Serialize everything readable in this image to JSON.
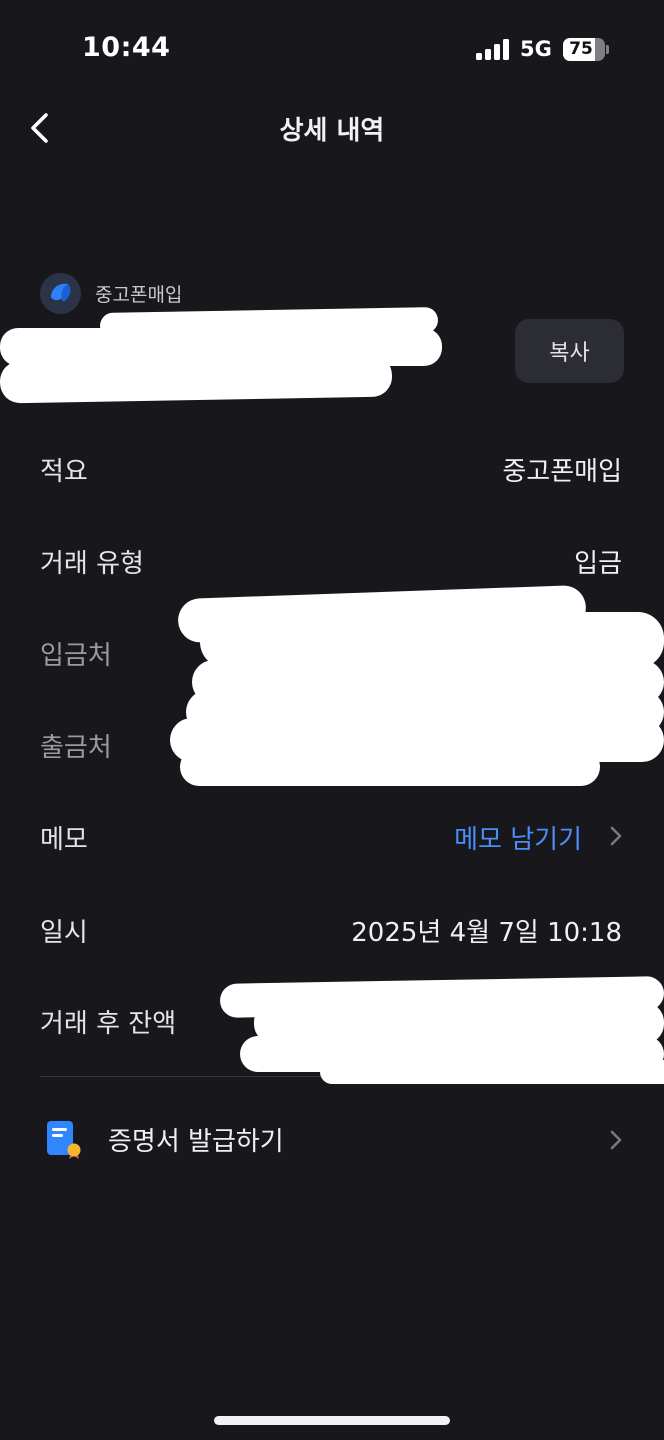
{
  "status_bar": {
    "time": "10:44",
    "network": "5G",
    "battery_percent": "75",
    "battery_level": 0.75,
    "signal_bars": 4
  },
  "header": {
    "back_icon": "chevron-left-icon",
    "title": "상세 내역"
  },
  "account": {
    "logo_icon": "bank-logo-icon",
    "name": "중고폰매입",
    "copy_label": "복사"
  },
  "details": {
    "summary_label": "적요",
    "summary_value": "중고폰매입",
    "type_label": "거래 유형",
    "type_value": "입금",
    "depositor_label": "입금처",
    "withdrawer_label": "출금처",
    "memo_label": "메모",
    "memo_action": "메모 남기기",
    "datetime_label": "일시",
    "datetime_value": "2025년 4월 7일 10:18",
    "balance_label": "거래 후 잔액"
  },
  "certificate": {
    "icon": "document-certificate-icon",
    "label": "증명서 발급하기"
  },
  "colors": {
    "background": "#17171c",
    "accent_link": "#4c8ef7",
    "button_bg": "#2c2c35"
  }
}
